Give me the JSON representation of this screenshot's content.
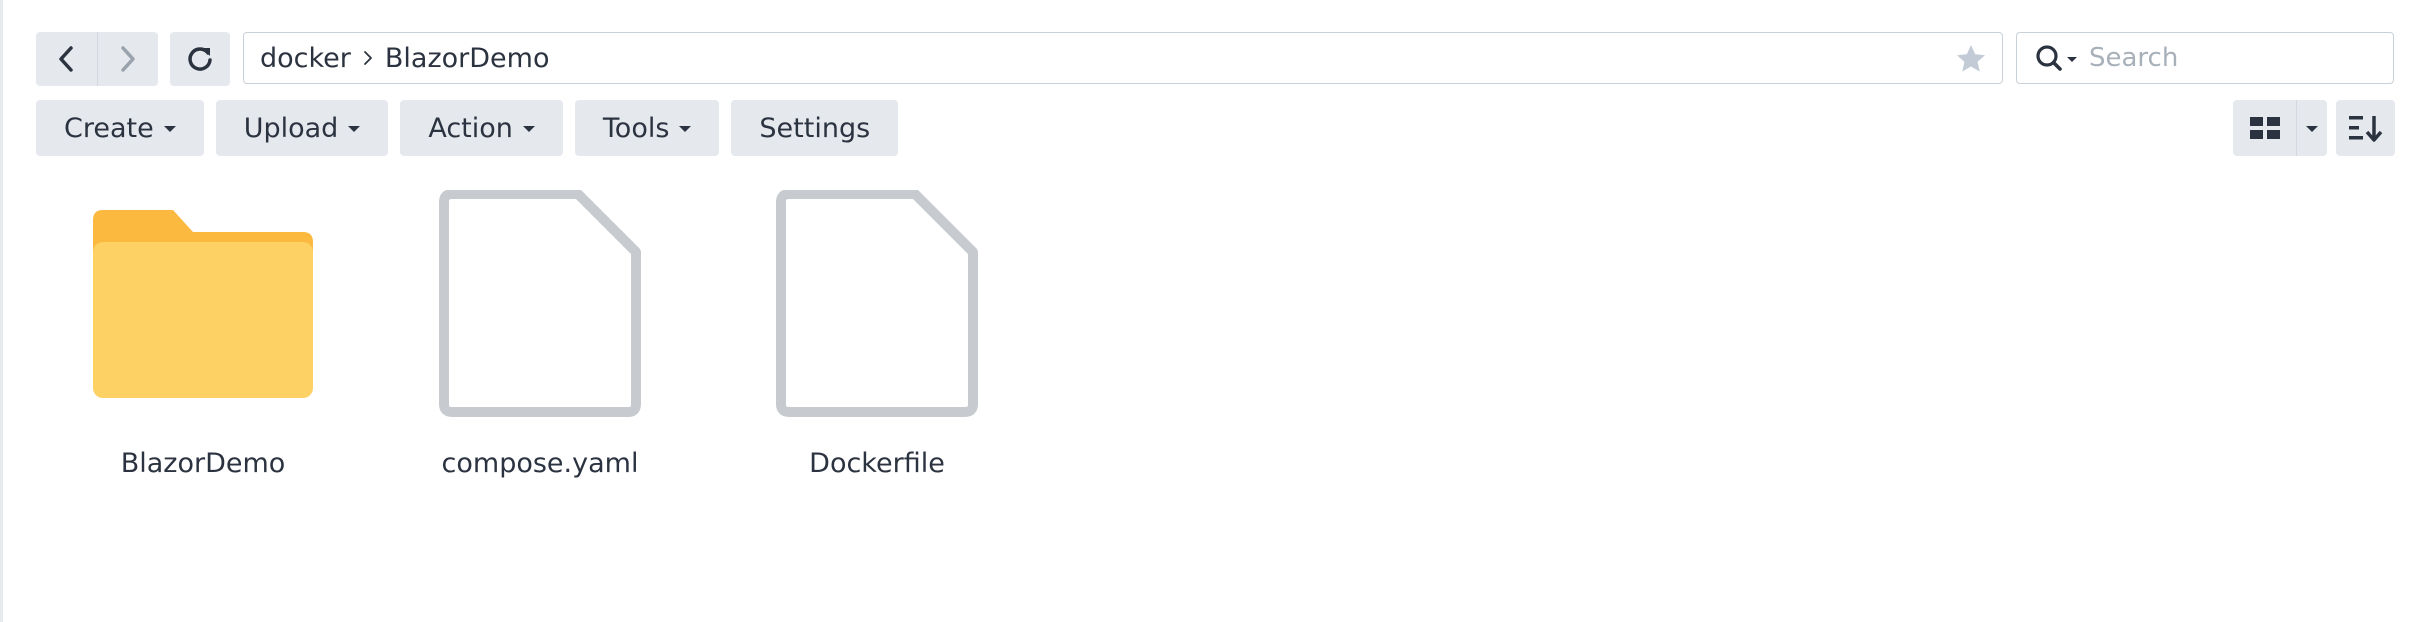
{
  "navigation": {
    "breadcrumb": [
      "docker",
      "BlazorDemo"
    ]
  },
  "search": {
    "placeholder": "Search",
    "value": ""
  },
  "toolbar": {
    "create_label": "Create",
    "upload_label": "Upload",
    "action_label": "Action",
    "tools_label": "Tools",
    "settings_label": "Settings"
  },
  "files": [
    {
      "name": "BlazorDemo",
      "type": "folder"
    },
    {
      "name": "compose.yaml",
      "type": "file"
    },
    {
      "name": "Dockerfile",
      "type": "file"
    }
  ],
  "icons": {
    "back": "chevron-left-icon",
    "forward": "chevron-right-icon",
    "refresh": "refresh-icon",
    "favorite": "star-icon",
    "search": "search-icon",
    "view": "grid-view-icon",
    "sort": "sort-icon",
    "folder": "folder-icon",
    "file": "file-icon"
  },
  "colors": {
    "folder_back": "#fbb940",
    "folder_front": "#fdd163",
    "file_outline": "#c7cace",
    "button_bg": "#e5e9ee",
    "text": "#2c3340",
    "forward_disabled": "#9aa3ad"
  }
}
